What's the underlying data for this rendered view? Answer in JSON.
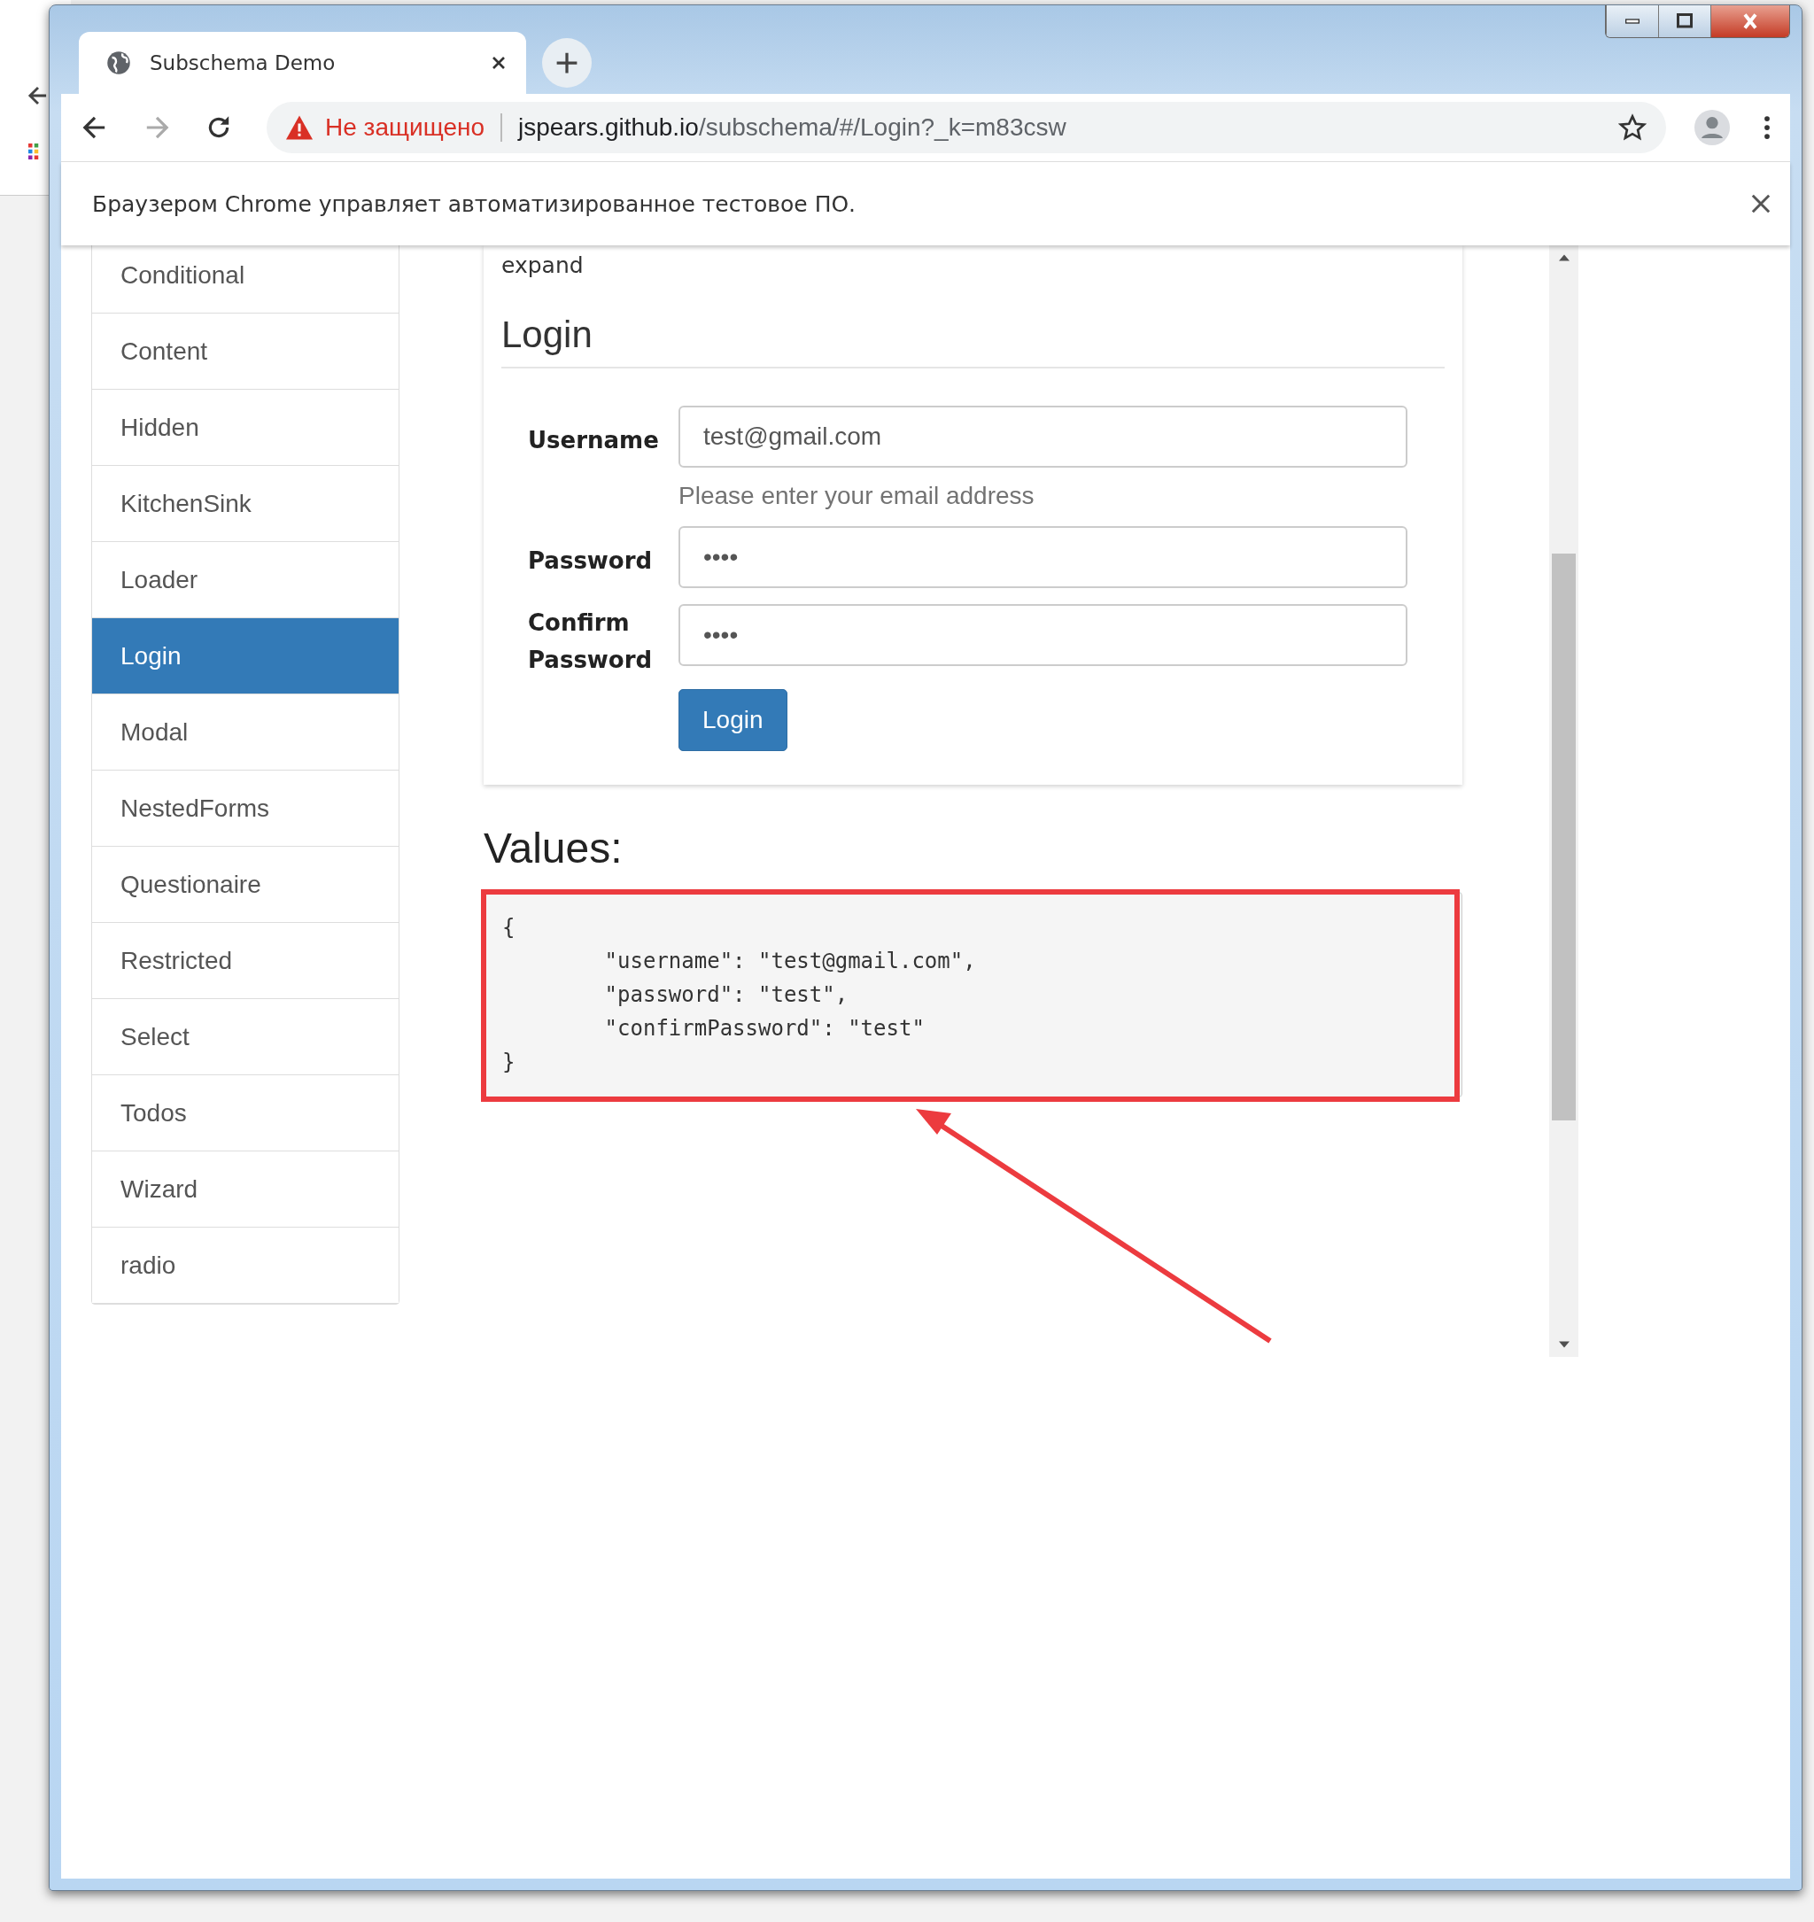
{
  "browser": {
    "tab": {
      "title": "Subschema Demo",
      "selected": true
    },
    "security": "Не защищено",
    "address": {
      "host": "jspears.github.io",
      "path": "/subschema/#/Login?_k=m83csw"
    },
    "infobar": "Браузером Chrome управляет автоматизированное тестовое ПО."
  },
  "sidebar": {
    "items": [
      {
        "label": "Conditional",
        "selected": false
      },
      {
        "label": "Content",
        "selected": false
      },
      {
        "label": "Hidden",
        "selected": false
      },
      {
        "label": "KitchenSink",
        "selected": false
      },
      {
        "label": "Loader",
        "selected": false
      },
      {
        "label": "Login",
        "selected": true
      },
      {
        "label": "Modal",
        "selected": false
      },
      {
        "label": "NestedForms",
        "selected": false
      },
      {
        "label": "Questionaire",
        "selected": false
      },
      {
        "label": "Restricted",
        "selected": false
      },
      {
        "label": "Select",
        "selected": false
      },
      {
        "label": "Todos",
        "selected": false
      },
      {
        "label": "Wizard",
        "selected": false
      },
      {
        "label": "radio",
        "selected": false
      }
    ]
  },
  "form": {
    "expand_link": "expand",
    "legend": "Login",
    "fields": [
      {
        "label": "Username",
        "value": "test@gmail.com",
        "help": "Please enter your email address"
      },
      {
        "label": "Password",
        "value": "••••"
      },
      {
        "label": "Confirm Password",
        "value": "••••"
      }
    ],
    "submit": "Login"
  },
  "values": {
    "heading": "Values:",
    "code": "{\n\t\"username\": \"test@gmail.com\",\n\t\"password\": \"test\",\n\t\"confirmPassword\": \"test\"\n}"
  }
}
